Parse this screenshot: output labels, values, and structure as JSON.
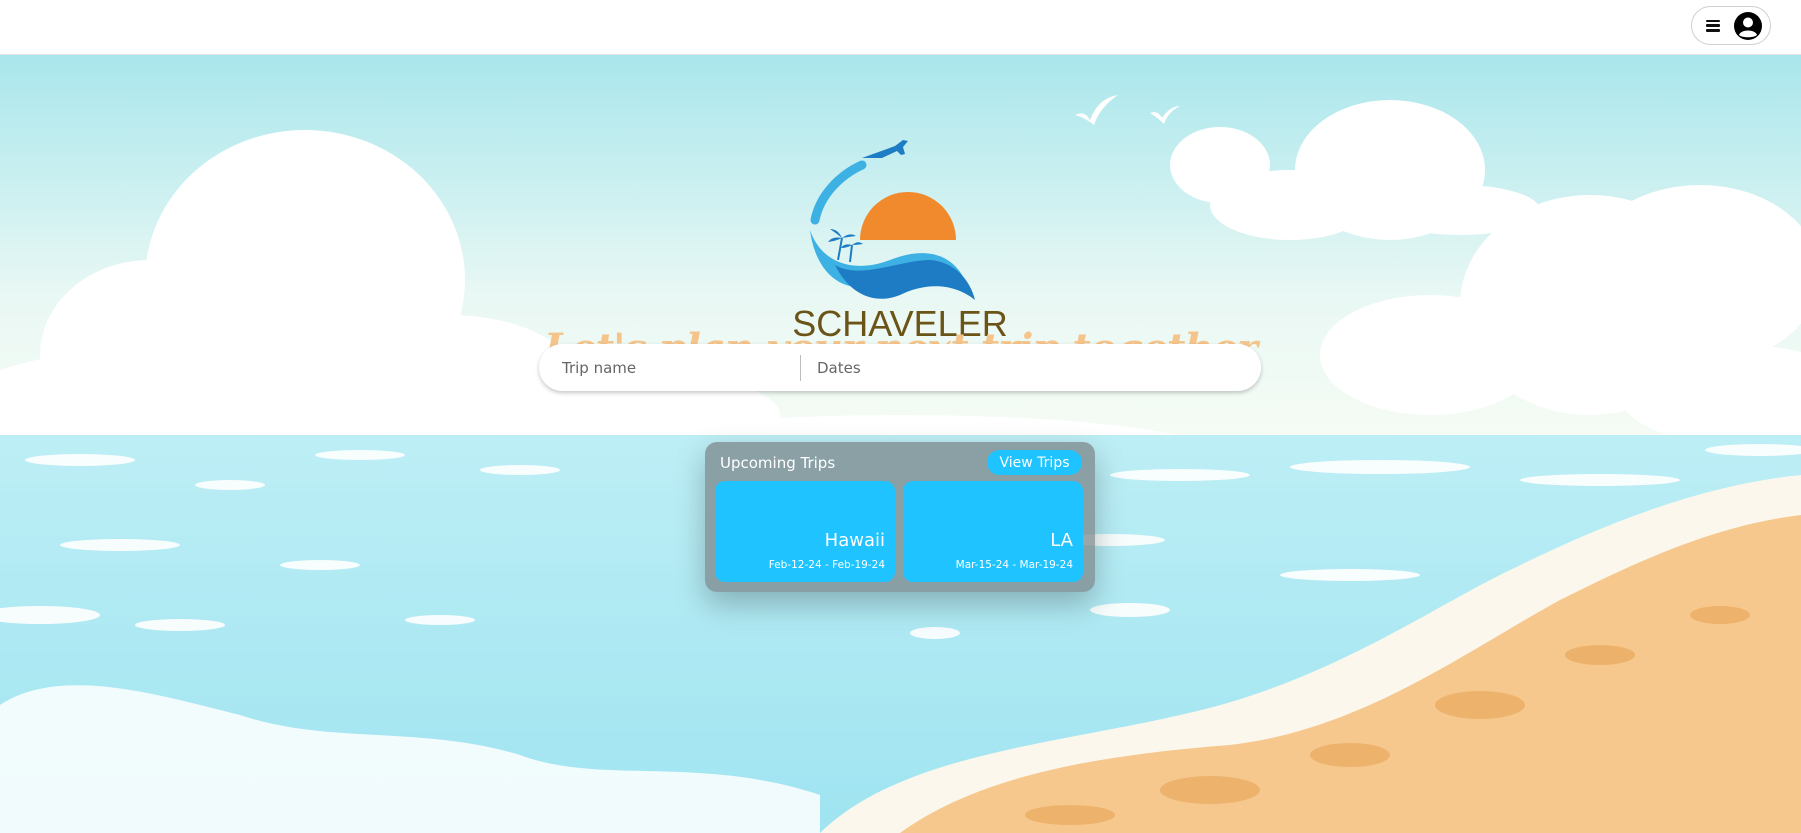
{
  "brand": {
    "name": "SCHAVELER"
  },
  "header": {
    "menu_icon": "hamburger-icon",
    "avatar_icon": "user-circle-icon"
  },
  "hero": {
    "tagline": "Let's plan your next trip together"
  },
  "search": {
    "trip_name_placeholder": "Trip name",
    "dates_placeholder": "Dates"
  },
  "upcoming": {
    "title": "Upcoming Trips",
    "view_button": "View Trips",
    "trips": [
      {
        "name": "Hawaii",
        "dates": "Feb-12-24 - Feb-19-24"
      },
      {
        "name": "LA",
        "dates": "Mar-15-24 - Mar-19-24"
      }
    ]
  },
  "colors": {
    "accent": "#1ec3ff",
    "tagline": "#f4c48a",
    "brand_text": "#6b5417",
    "sun": "#f08a2c",
    "wave": "#1d7cc4"
  }
}
